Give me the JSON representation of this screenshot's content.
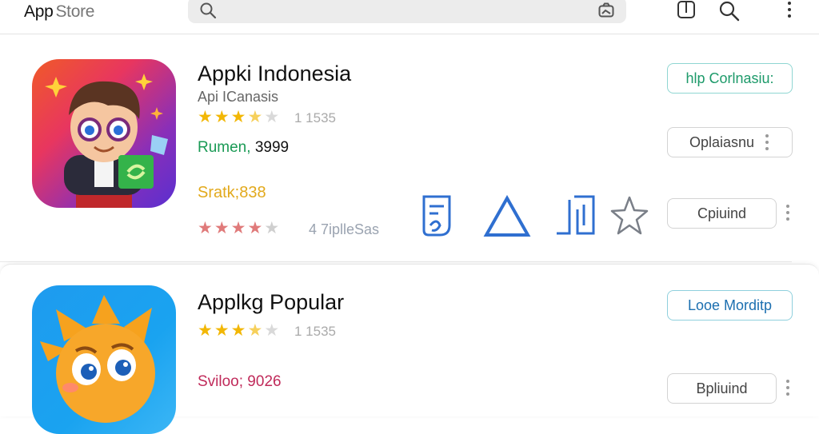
{
  "header": {
    "brand_app": "App",
    "brand_store": "Store",
    "search": {
      "value": "",
      "placeholder": ""
    },
    "icons": [
      "search-icon",
      "photo-icon",
      "bookmark-icon",
      "search-icon",
      "more-vertical-icon"
    ]
  },
  "apps": [
    {
      "title": "Appki Indonesia",
      "subtitle": "Api ICanasis",
      "rating_stars": 3.5,
      "rating_count": "1 1535",
      "price_line_label": "Rumen,",
      "price_line_value": "3999",
      "size_line": "Sratk;838",
      "secondary_stars": 4,
      "secondary_count": "4 7iplleSas",
      "buttons": {
        "primary": "hlp Corlnasiu:",
        "secondary": "Oplaiasnu",
        "tertiary": "Cpiuind"
      },
      "feature_icons": [
        "document-icon",
        "triangle-icon",
        "bracket-icon",
        "star-outline-icon"
      ]
    },
    {
      "title": "Applkg Popular",
      "rating_stars": 3.5,
      "rating_count": "1 1535",
      "size_line": "Sviloo; 9026",
      "buttons": {
        "primary": "Looe Morditp",
        "tertiary": "Bpliuind"
      }
    }
  ],
  "colors": {
    "accent_green": "#1a9a55",
    "accent_blue": "#1c6fb0",
    "star_gold": "#f2b705",
    "icon_blue": "#2f6fd0"
  }
}
